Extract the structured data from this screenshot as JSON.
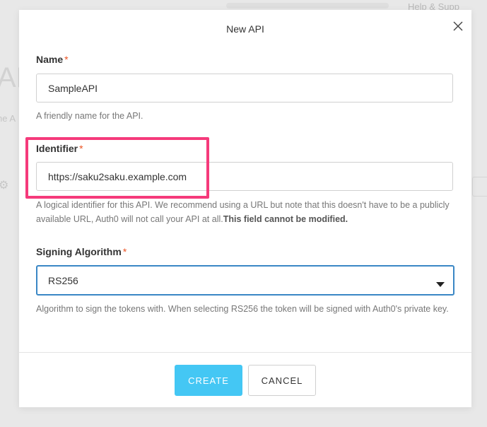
{
  "background": {
    "help_text": "Help & Supp",
    "page_title": "API",
    "page_subtitle": "ne A"
  },
  "modal": {
    "title": "New API",
    "name_field": {
      "label": "Name",
      "required_mark": "*",
      "value": "SampleAPI",
      "help": "A friendly name for the API."
    },
    "identifier_field": {
      "label": "Identifier",
      "required_mark": "*",
      "value": "https://saku2saku.example.com",
      "help": "A logical identifier for this API. We recommend using a URL but note that this doesn't have to be a publicly available URL, Auth0 will not call your API at all.",
      "help_bold": "This field cannot be modified."
    },
    "signing_field": {
      "label": "Signing Algorithm",
      "required_mark": "*",
      "value": "RS256",
      "help": "Algorithm to sign the tokens with. When selecting RS256 the token will be signed with Auth0's private key."
    },
    "create_label": "CREATE",
    "cancel_label": "CANCEL"
  },
  "colors": {
    "accent": "#44c7f4",
    "focus_border": "#3a87c5",
    "highlight": "#f53a7b",
    "required": "#eb5424"
  },
  "icons": {
    "close": "close-icon",
    "dropdown": "caret-down-icon",
    "settings": "gear-icon"
  }
}
